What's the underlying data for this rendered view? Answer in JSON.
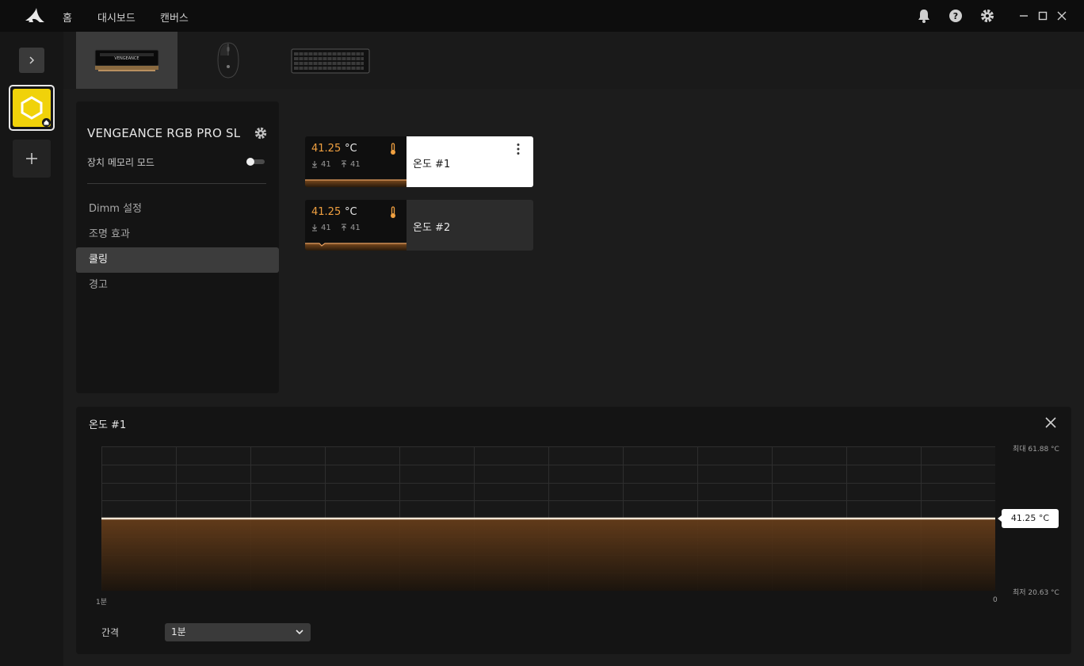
{
  "nav": {
    "home": "홈",
    "dashboard": "대시보드",
    "canvas": "캔버스"
  },
  "device": {
    "name": "VENGEANCE RGB PRO SL",
    "memory_mode_label": "장치 메모리 모드",
    "memory_mode_on": false
  },
  "menu": {
    "items": [
      {
        "label": "Dimm 설정"
      },
      {
        "label": "조명 효과"
      },
      {
        "label": "쿨링",
        "active": true
      },
      {
        "label": "경고"
      }
    ]
  },
  "sensors": [
    {
      "name": "온도 #1",
      "value": "41.25",
      "unit": "°C",
      "min": "41",
      "max": "41",
      "selected": true
    },
    {
      "name": "온도 #2",
      "value": "41.25",
      "unit": "°C",
      "min": "41",
      "max": "41",
      "selected": false
    }
  ],
  "graph": {
    "title": "온도 #1",
    "max_label": "최대 61.88 °C",
    "min_label": "최저 20.63 °C",
    "current_label": "41.25 °C",
    "x_start": "1분",
    "x_end": "0",
    "interval_label": "간격",
    "interval_value": "1분"
  },
  "chart_data": {
    "type": "area",
    "x": [
      "1분",
      "0"
    ],
    "series": [
      {
        "values": [
          41.25,
          41.25
        ]
      }
    ],
    "ylim": [
      20.63,
      61.88
    ],
    "grid": true
  },
  "colors": {
    "accent": "#f0a040",
    "device_tile": "#f0d20a"
  }
}
